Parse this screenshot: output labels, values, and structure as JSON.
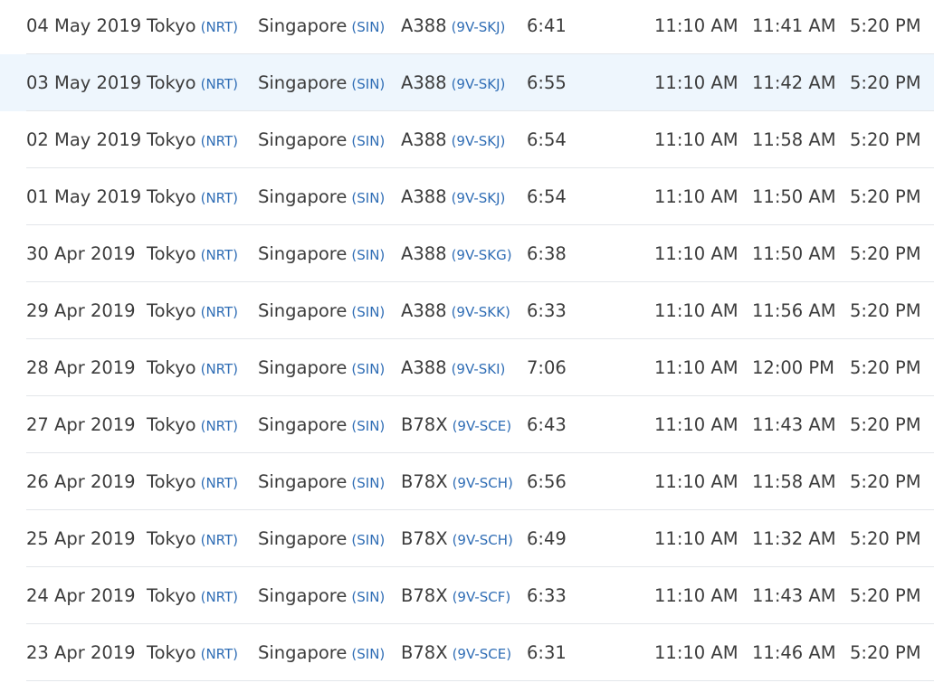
{
  "flights": [
    {
      "date": "04 May 2019",
      "from_city": "Tokyo",
      "from_code": "(NRT)",
      "to_city": "Singapore",
      "to_code": "(SIN)",
      "aircraft": "A388",
      "registration": "(9V-SKJ)",
      "duration": "6:41",
      "scheduled_departure": "11:10 AM",
      "actual_departure": "11:41 AM",
      "scheduled_arrival": "5:20 PM",
      "highlighted": false
    },
    {
      "date": "03 May 2019",
      "from_city": "Tokyo",
      "from_code": "(NRT)",
      "to_city": "Singapore",
      "to_code": "(SIN)",
      "aircraft": "A388",
      "registration": "(9V-SKJ)",
      "duration": "6:55",
      "scheduled_departure": "11:10 AM",
      "actual_departure": "11:42 AM",
      "scheduled_arrival": "5:20 PM",
      "highlighted": true
    },
    {
      "date": "02 May 2019",
      "from_city": "Tokyo",
      "from_code": "(NRT)",
      "to_city": "Singapore",
      "to_code": "(SIN)",
      "aircraft": "A388",
      "registration": "(9V-SKJ)",
      "duration": "6:54",
      "scheduled_departure": "11:10 AM",
      "actual_departure": "11:58 AM",
      "scheduled_arrival": "5:20 PM",
      "highlighted": false
    },
    {
      "date": "01 May 2019",
      "from_city": "Tokyo",
      "from_code": "(NRT)",
      "to_city": "Singapore",
      "to_code": "(SIN)",
      "aircraft": "A388",
      "registration": "(9V-SKJ)",
      "duration": "6:54",
      "scheduled_departure": "11:10 AM",
      "actual_departure": "11:50 AM",
      "scheduled_arrival": "5:20 PM",
      "highlighted": false
    },
    {
      "date": "30 Apr 2019",
      "from_city": "Tokyo",
      "from_code": "(NRT)",
      "to_city": "Singapore",
      "to_code": "(SIN)",
      "aircraft": "A388",
      "registration": "(9V-SKG)",
      "duration": "6:38",
      "scheduled_departure": "11:10 AM",
      "actual_departure": "11:50 AM",
      "scheduled_arrival": "5:20 PM",
      "highlighted": false
    },
    {
      "date": "29 Apr 2019",
      "from_city": "Tokyo",
      "from_code": "(NRT)",
      "to_city": "Singapore",
      "to_code": "(SIN)",
      "aircraft": "A388",
      "registration": "(9V-SKK)",
      "duration": "6:33",
      "scheduled_departure": "11:10 AM",
      "actual_departure": "11:56 AM",
      "scheduled_arrival": "5:20 PM",
      "highlighted": false
    },
    {
      "date": "28 Apr 2019",
      "from_city": "Tokyo",
      "from_code": "(NRT)",
      "to_city": "Singapore",
      "to_code": "(SIN)",
      "aircraft": "A388",
      "registration": "(9V-SKI)",
      "duration": "7:06",
      "scheduled_departure": "11:10 AM",
      "actual_departure": "12:00 PM",
      "scheduled_arrival": "5:20 PM",
      "highlighted": false
    },
    {
      "date": "27 Apr 2019",
      "from_city": "Tokyo",
      "from_code": "(NRT)",
      "to_city": "Singapore",
      "to_code": "(SIN)",
      "aircraft": "B78X",
      "registration": "(9V-SCE)",
      "duration": "6:43",
      "scheduled_departure": "11:10 AM",
      "actual_departure": "11:43 AM",
      "scheduled_arrival": "5:20 PM",
      "highlighted": false
    },
    {
      "date": "26 Apr 2019",
      "from_city": "Tokyo",
      "from_code": "(NRT)",
      "to_city": "Singapore",
      "to_code": "(SIN)",
      "aircraft": "B78X",
      "registration": "(9V-SCH)",
      "duration": "6:56",
      "scheduled_departure": "11:10 AM",
      "actual_departure": "11:58 AM",
      "scheduled_arrival": "5:20 PM",
      "highlighted": false
    },
    {
      "date": "25 Apr 2019",
      "from_city": "Tokyo",
      "from_code": "(NRT)",
      "to_city": "Singapore",
      "to_code": "(SIN)",
      "aircraft": "B78X",
      "registration": "(9V-SCH)",
      "duration": "6:49",
      "scheduled_departure": "11:10 AM",
      "actual_departure": "11:32 AM",
      "scheduled_arrival": "5:20 PM",
      "highlighted": false
    },
    {
      "date": "24 Apr 2019",
      "from_city": "Tokyo",
      "from_code": "(NRT)",
      "to_city": "Singapore",
      "to_code": "(SIN)",
      "aircraft": "B78X",
      "registration": "(9V-SCF)",
      "duration": "6:33",
      "scheduled_departure": "11:10 AM",
      "actual_departure": "11:43 AM",
      "scheduled_arrival": "5:20 PM",
      "highlighted": false
    },
    {
      "date": "23 Apr 2019",
      "from_city": "Tokyo",
      "from_code": "(NRT)",
      "to_city": "Singapore",
      "to_code": "(SIN)",
      "aircraft": "B78X",
      "registration": "(9V-SCE)",
      "duration": "6:31",
      "scheduled_departure": "11:10 AM",
      "actual_departure": "11:46 AM",
      "scheduled_arrival": "5:20 PM",
      "highlighted": false
    }
  ],
  "colors": {
    "text": "#3c3c3c",
    "code_link": "#2f6db5",
    "row_highlight": "#eef6fd",
    "divider": "#e3e6ea"
  }
}
